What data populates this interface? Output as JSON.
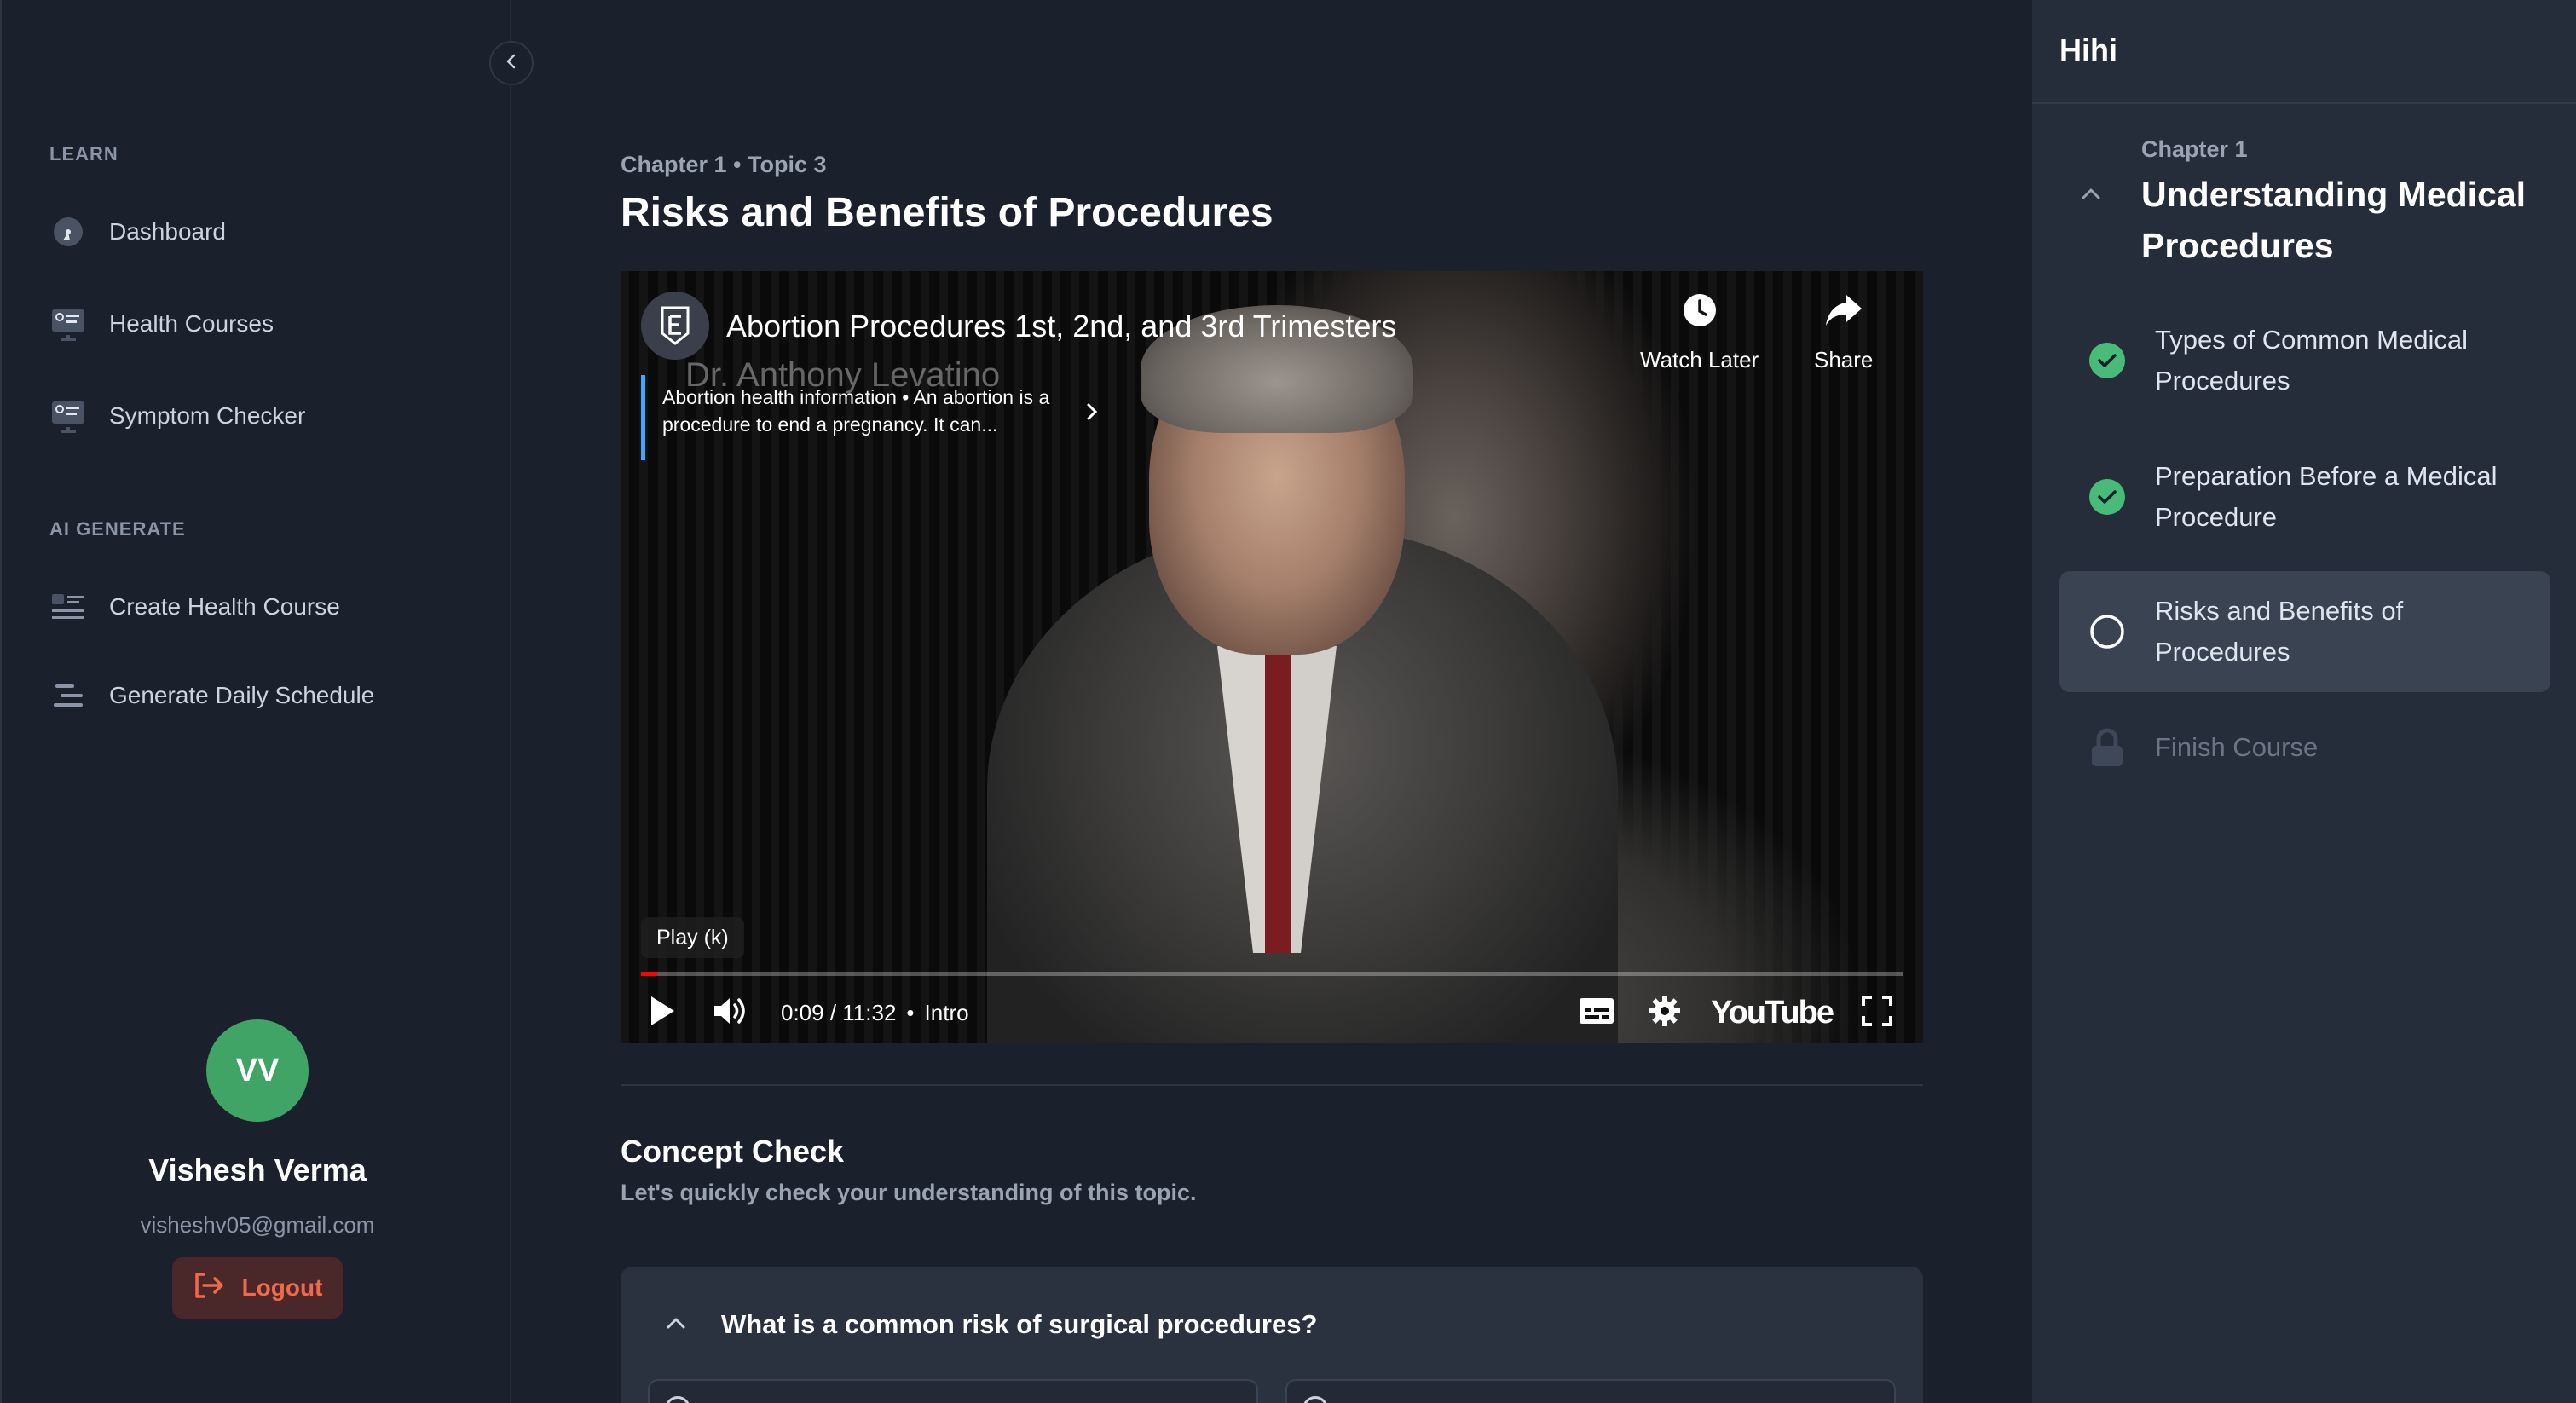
{
  "sidebar": {
    "learn_label": "LEARN",
    "learn_items": [
      {
        "label": "Dashboard",
        "icon": "gauge-icon"
      },
      {
        "label": "Health Courses",
        "icon": "monitor-list-icon"
      },
      {
        "label": "Symptom Checker",
        "icon": "monitor-list-icon"
      }
    ],
    "ai_label": "AI GENERATE",
    "ai_items": [
      {
        "label": "Create Health Course",
        "icon": "list-card-icon"
      },
      {
        "label": "Generate Daily Schedule",
        "icon": "align-lines-icon"
      }
    ],
    "profile": {
      "initials": "VV",
      "name": "Vishesh Verma",
      "email": "visheshv05@gmail.com",
      "logout_label": "Logout"
    }
  },
  "main": {
    "breadcrumb": "Chapter 1 • Topic 3",
    "title": "Risks and Benefits of Procedures",
    "video": {
      "title": "Abortion Procedures 1st, 2nd, and 3rd Trimesters",
      "watermark": "Dr. Anthony Levatino",
      "watch_later_label": "Watch Later",
      "share_label": "Share",
      "info_card_text": "Abortion health information • An abortion is a procedure to end a pregnancy. It can...",
      "tooltip": "Play (k)",
      "time": "0:09 / 11:32",
      "chapter": "Intro",
      "brand": "YouTube",
      "progress_fraction": 0.013
    },
    "concept_check": {
      "title": "Concept Check",
      "subtitle": "Let's quickly check your understanding of this topic.",
      "question": "What is a common risk of surgical procedures?"
    }
  },
  "course_panel": {
    "course_title": "Hihi",
    "chapter_label": "Chapter 1",
    "chapter_title": "Understanding Medical Procedures",
    "topics": [
      {
        "label": "Types of Common Medical Procedures",
        "status": "completed"
      },
      {
        "label": "Preparation Before a Medical Procedure",
        "status": "completed"
      },
      {
        "label": "Risks and Benefits of Procedures",
        "status": "current"
      },
      {
        "label": "Finish Course",
        "status": "locked"
      }
    ]
  },
  "colors": {
    "background": "#1a202c",
    "panel": "#262d3a",
    "accent_green": "#3fa466",
    "logout_red": "#ef6a4a",
    "youtube_red": "#ff0000"
  }
}
